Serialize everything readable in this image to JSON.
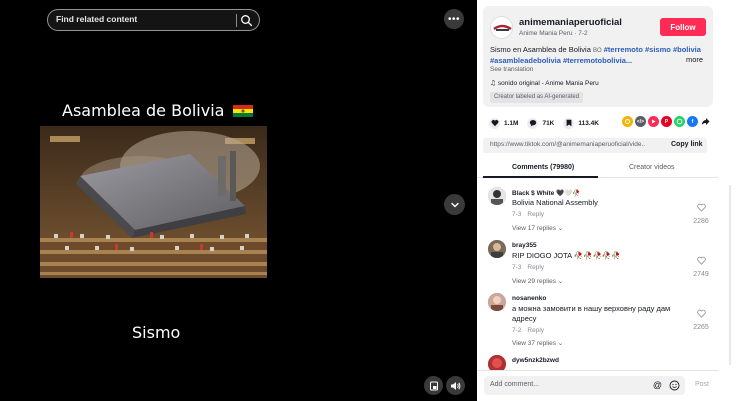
{
  "search": {
    "placeholder": "Find related content"
  },
  "video": {
    "title": "Asamblea de Bolivia",
    "caption": "Sismo"
  },
  "author": {
    "username": "animemaniaperuoficial",
    "display": "Anime Mania Peru · 7-2",
    "follow_label": "Follow"
  },
  "description": {
    "text_prefix": "Sismo en Asamblea de Bolivia ",
    "flag": "BO",
    "tags_line1": "#terremoto #sismo #bolivia",
    "tags_line2": "#asambleadebolivia #terremotobolivia...",
    "more": "more",
    "see_translation": "See translation",
    "sound": "sonido original - Anime Mania Peru",
    "ai_label": "Creator labeled as AI-generated"
  },
  "stats": {
    "likes": "1.1M",
    "comments": "71K",
    "saves": "113.4K"
  },
  "share_icons": [
    "coin",
    "embed",
    "repost",
    "pinterest",
    "whatsapp",
    "facebook",
    "share-arrow"
  ],
  "link": {
    "url": "https://www.tiktok.com/@animemaniaperuoficial/vide...",
    "copy_label": "Copy link"
  },
  "tabs": {
    "comments": "Comments (79980)",
    "creator": "Creator videos"
  },
  "comments": [
    {
      "user": "Black $ White 🖤🤍🥀",
      "text": "Bolivia National Assembly",
      "date": "7-3",
      "reply": "Reply",
      "replies": "View 17 replies",
      "likes": "2286"
    },
    {
      "user": "bray355",
      "text": "RIP DIOGO JOTA 🥀🥀🥀🥀🥀",
      "date": "7-3",
      "reply": "Reply",
      "replies": "View 29 replies",
      "likes": "2749"
    },
    {
      "user": "nosanenko",
      "text": "а можна замовити в нашу верховну раду дам адресу",
      "date": "7-2",
      "reply": "Reply",
      "replies": "View 37 replies",
      "likes": "2265"
    },
    {
      "user": "dyw5nzk2bzwd"
    }
  ],
  "add_comment": {
    "placeholder": "Add comment...",
    "post": "Post"
  },
  "colors": {
    "follow": "#fe2c55",
    "hashtag": "#2b5db9",
    "video_bg": "#000000"
  }
}
